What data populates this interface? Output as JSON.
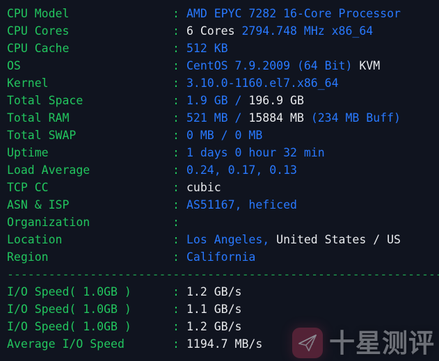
{
  "terminal": {
    "background_color": "#10141f",
    "label_color": "#22c55e",
    "value_blue": "#2979ff",
    "value_white": "#e8eaed",
    "colon": ":"
  },
  "system_info": [
    {
      "label": "CPU Model",
      "segments": [
        {
          "text": "AMD EPYC 7282 16-Core Processor",
          "color": "blue"
        }
      ]
    },
    {
      "label": "CPU Cores",
      "segments": [
        {
          "text": "6 Cores ",
          "color": "white"
        },
        {
          "text": "2794.748 MHz x86_64",
          "color": "blue"
        }
      ]
    },
    {
      "label": "CPU Cache",
      "segments": [
        {
          "text": "512 KB",
          "color": "blue"
        }
      ]
    },
    {
      "label": "OS",
      "segments": [
        {
          "text": "CentOS 7.9.2009 (64 Bit) ",
          "color": "blue"
        },
        {
          "text": "KVM",
          "color": "white"
        }
      ]
    },
    {
      "label": "Kernel",
      "segments": [
        {
          "text": "3.10.0-1160.el7.x86_64",
          "color": "blue"
        }
      ]
    },
    {
      "label": "Total Space",
      "segments": [
        {
          "text": "1.9 GB / ",
          "color": "blue"
        },
        {
          "text": "196.9 GB",
          "color": "white"
        }
      ]
    },
    {
      "label": "Total RAM",
      "segments": [
        {
          "text": "521 MB / ",
          "color": "blue"
        },
        {
          "text": "15884 MB ",
          "color": "white"
        },
        {
          "text": "(234 MB Buff)",
          "color": "blue"
        }
      ]
    },
    {
      "label": "Total SWAP",
      "segments": [
        {
          "text": "0 MB / 0 MB",
          "color": "blue"
        }
      ]
    },
    {
      "label": "Uptime",
      "segments": [
        {
          "text": "1 days 0 hour 32 min",
          "color": "blue"
        }
      ]
    },
    {
      "label": "Load Average",
      "segments": [
        {
          "text": "0.24, 0.17, 0.13",
          "color": "blue"
        }
      ]
    },
    {
      "label": "TCP CC",
      "segments": [
        {
          "text": "cubic",
          "color": "white"
        }
      ]
    },
    {
      "label": "ASN & ISP",
      "segments": [
        {
          "text": "AS51167, heficed",
          "color": "blue"
        }
      ]
    },
    {
      "label": "Organization",
      "segments": [
        {
          "text": "",
          "color": "blue"
        }
      ]
    },
    {
      "label": "Location",
      "segments": [
        {
          "text": "Los Angeles, ",
          "color": "blue"
        },
        {
          "text": "United States / US",
          "color": "white"
        }
      ]
    },
    {
      "label": "Region",
      "segments": [
        {
          "text": "California",
          "color": "blue"
        }
      ]
    }
  ],
  "divider": "----------------------------------------------------------------------",
  "io_results": [
    {
      "label": "I/O Speed( 1.0GB )",
      "segments": [
        {
          "text": "1.2 GB/s",
          "color": "white"
        }
      ]
    },
    {
      "label": "I/O Speed( 1.0GB )",
      "segments": [
        {
          "text": "1.1 GB/s",
          "color": "white"
        }
      ]
    },
    {
      "label": "I/O Speed( 1.0GB )",
      "segments": [
        {
          "text": "1.2 GB/s",
          "color": "white"
        }
      ]
    },
    {
      "label": "Average I/O Speed",
      "segments": [
        {
          "text": "1194.7 MB/s",
          "color": "white"
        }
      ]
    }
  ],
  "watermark": {
    "text": "十星测评",
    "icon": "paper-plane-icon",
    "badge_color": "#7d2b45"
  }
}
